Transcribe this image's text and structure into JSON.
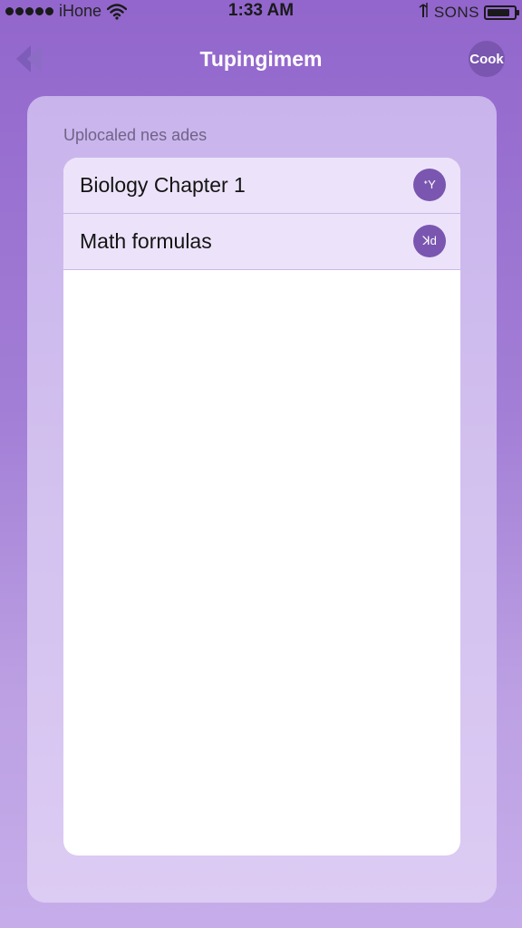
{
  "status_bar": {
    "carrier": "iHone",
    "time": "1:33 AM",
    "extra": "SONS",
    "signal_icon": "signal-dots-icon",
    "wifi_icon": "wifi-icon",
    "battery_icon": "battery-icon"
  },
  "nav": {
    "title": "Tupingimem",
    "back_icon": "double-chevron-left-icon",
    "right_button_label": "Cook"
  },
  "section": {
    "label": "Uplocaled nes ades"
  },
  "list": {
    "items": [
      {
        "label": "Biology Chapter 1",
        "action_glyph": "ᐩY"
      },
      {
        "label": "Math formulas",
        "action_glyph": "ꓘd"
      }
    ]
  },
  "colors": {
    "background": "#9266cc",
    "accent": "#7a56b0",
    "card": "#d3c1ef",
    "row": "#ece3fa",
    "title_text": "#ffffff"
  }
}
